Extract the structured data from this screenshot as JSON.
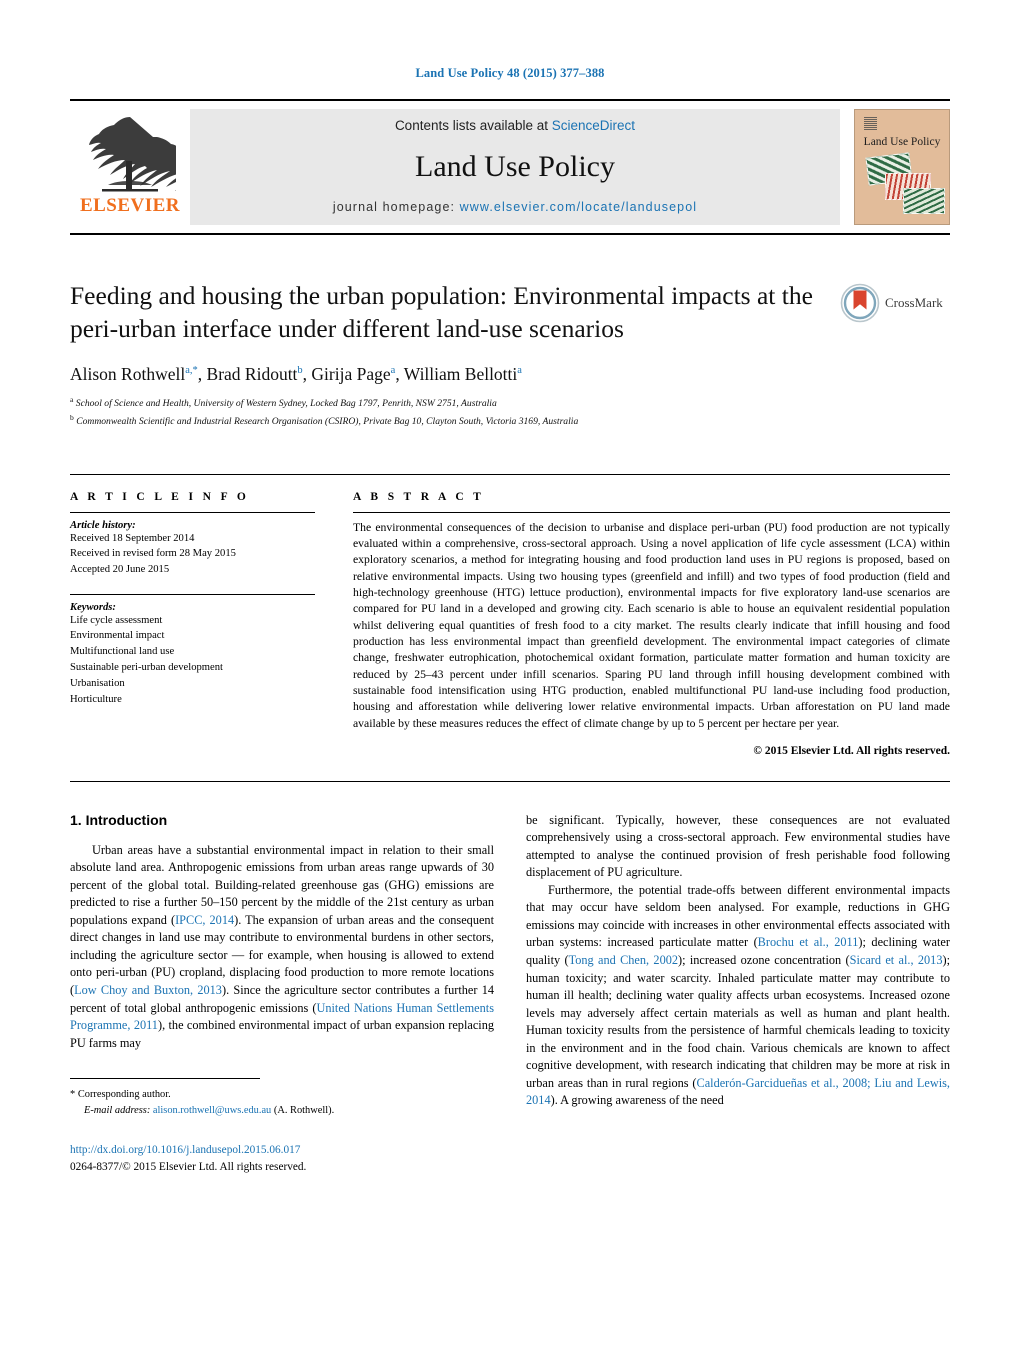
{
  "running_head": "Land Use Policy 48 (2015) 377–388",
  "masthead": {
    "publisher": "ELSEVIER",
    "contents_prefix": "Contents lists available at ",
    "contents_link": "ScienceDirect",
    "journal_title": "Land Use Policy",
    "homepage_prefix": "journal homepage: ",
    "homepage_url": "www.elsevier.com/locate/landusepol",
    "cover_title": "Land Use Policy"
  },
  "article": {
    "title": "Feeding and housing the urban population: Environmental impacts at the peri-urban interface under different land-use scenarios",
    "crossmark_label": "CrossMark",
    "authors_html": "Alison Rothwell<sup>a,*</sup>, Brad Ridoutt<sup>b</sup>, Girija Page<sup>a</sup>, William Bellotti<sup>a</sup>",
    "affiliations": [
      {
        "marker": "a",
        "text": "School of Science and Health, University of Western Sydney, Locked Bag 1797, Penrith, NSW 2751, Australia"
      },
      {
        "marker": "b",
        "text": "Commonwealth Scientific and Industrial Research Organisation (CSIRO), Private Bag 10, Clayton South, Victoria 3169, Australia"
      }
    ]
  },
  "article_info": {
    "heading": "A R T I C L E   I N F O",
    "history_label": "Article history:",
    "history": [
      "Received 18 September 2014",
      "Received in revised form 28 May 2015",
      "Accepted 20 June 2015"
    ],
    "keywords_label": "Keywords:",
    "keywords": [
      "Life cycle assessment",
      "Environmental impact",
      "Multifunctional land use",
      "Sustainable peri-urban development",
      "Urbanisation",
      "Horticulture"
    ]
  },
  "abstract": {
    "heading": "A B S T R A C T",
    "text": "The environmental consequences of the decision to urbanise and displace peri-urban (PU) food production are not typically evaluated within a comprehensive, cross-sectoral approach. Using a novel application of life cycle assessment (LCA) within exploratory scenarios, a method for integrating housing and food production land uses in PU regions is proposed, based on relative environmental impacts. Using two housing types (greenfield and infill) and two types of food production (field and high-technology greenhouse (HTG) lettuce production), environmental impacts for five exploratory land-use scenarios are compared for PU land in a developed and growing city. Each scenario is able to house an equivalent residential population whilst delivering equal quantities of fresh food to a city market. The results clearly indicate that infill housing and food production has less environmental impact than greenfield development. The environmental impact categories of climate change, freshwater eutrophication, photochemical oxidant formation, particulate matter formation and human toxicity are reduced by 25–43 percent under infill scenarios. Sparing PU land through infill housing development combined with sustainable food intensification using HTG production, enabled multifunctional PU land-use including food production, housing and afforestation while delivering lower relative environmental impacts. Urban afforestation on PU land made available by these measures reduces the effect of climate change by up to 5 percent per hectare per year.",
    "copyright": "© 2015 Elsevier Ltd. All rights reserved."
  },
  "body": {
    "section_heading": "1. Introduction",
    "left_paragraphs_html": [
      "Urban areas have a substantial environmental impact in relation to their small absolute land area. Anthropogenic emissions from urban areas range upwards of 30 percent of the global total. Building-related greenhouse gas (GHG) emissions are predicted to rise a further 50–150 percent by the middle of the 21st century as urban populations expand (<span class=\"ref\">IPCC, 2014</span>). The expansion of urban areas and the consequent direct changes in land use may contribute to environmental burdens in other sectors, including the agriculture sector — for example, when housing is allowed to extend onto peri-urban (PU) cropland, displacing food production to more remote locations (<span class=\"ref\">Low Choy and Buxton, 2013</span>). Since the agriculture sector contributes a further 14 percent of total global anthropogenic emissions (<span class=\"ref\">United Nations Human Settlements Programme, 2011</span>), the combined environmental impact of urban expansion replacing PU farms may"
    ],
    "right_paragraphs_html": [
      "be significant. Typically, however, these consequences are not evaluated comprehensively using a cross-sectoral approach. Few environmental studies have attempted to analyse the continued provision of fresh perishable food following displacement of PU agriculture.",
      "Furthermore, the potential trade-offs between different environmental impacts that may occur have seldom been analysed. For example, reductions in GHG emissions may coincide with increases in other environmental effects associated with urban systems: increased particulate matter (<span class=\"ref\">Brochu et al., 2011</span>); declining water quality (<span class=\"ref\">Tong and Chen, 2002</span>); increased ozone concentration (<span class=\"ref\">Sicard et al., 2013</span>); human toxicity; and water scarcity. Inhaled particulate matter may contribute to human ill health; declining water quality affects urban ecosystems. Increased ozone levels may adversely affect certain materials as well as human and plant health. Human toxicity results from the persistence of harmful chemicals leading to toxicity in the environment and in the food chain. Various chemicals are known to affect cognitive development, with research indicating that children may be more at risk in urban areas than in rural regions (<span class=\"ref\">Calderón-Garcidueñas et al., 2008; Liu and Lewis, 2014</span>). A growing awareness of the need"
    ]
  },
  "footer": {
    "corresponding_marker": "*",
    "corresponding_text": "Corresponding author.",
    "email_label": "E-mail address:",
    "email": "alison.rothwell@uws.edu.au",
    "email_suffix": "(A. Rothwell).",
    "doi": "http://dx.doi.org/10.1016/j.landusepol.2015.06.017",
    "issn_line": "0264-8377/© 2015 Elsevier Ltd. All rights reserved."
  },
  "colors": {
    "link": "#1b73b3",
    "elsevier_orange": "#f06f1e",
    "masthead_grey": "#e8e8e8",
    "cover_tan": "#e2bc9a"
  }
}
